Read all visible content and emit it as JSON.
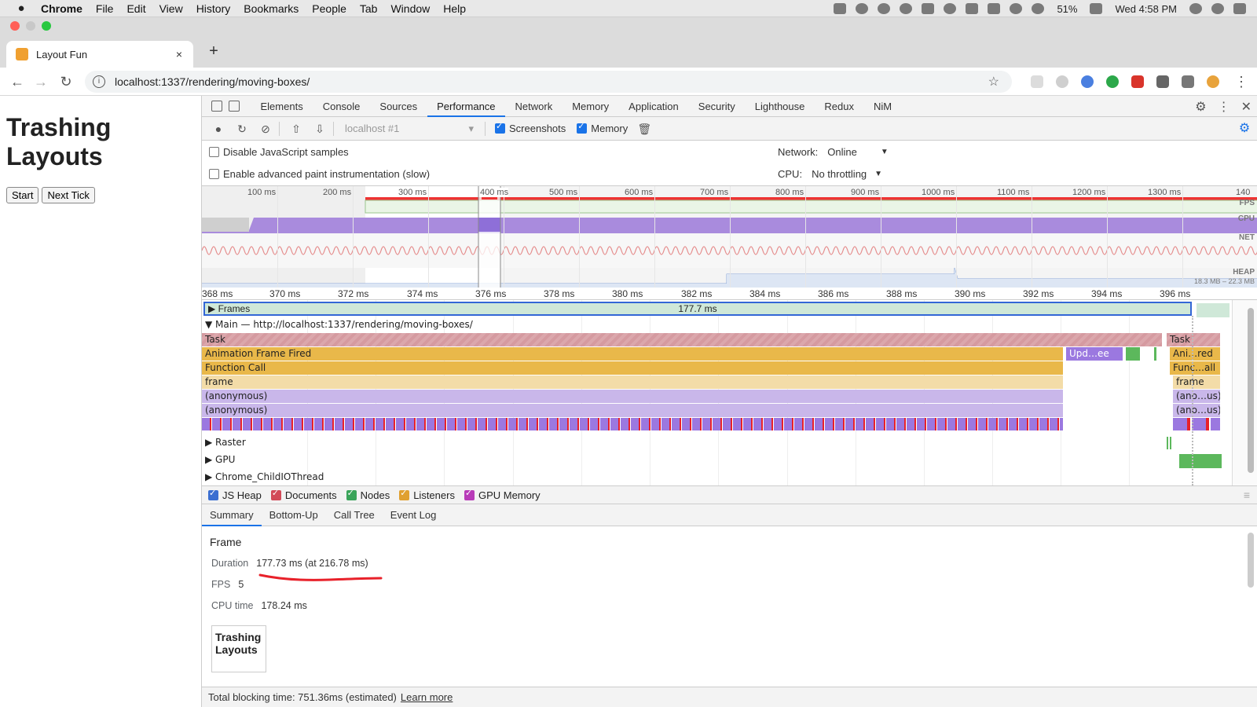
{
  "menubar": {
    "apple": "",
    "items": [
      "Chrome",
      "File",
      "Edit",
      "View",
      "History",
      "Bookmarks",
      "People",
      "Tab",
      "Window",
      "Help"
    ],
    "battery": "51%",
    "clock": "Wed 4:58 PM"
  },
  "browser": {
    "tab_title": "Layout Fun",
    "tab_close": "×",
    "new_tab": "+",
    "url": "localhost:1337/rendering/moving-boxes/",
    "back": "←",
    "forward": "→",
    "reload": "↻",
    "info": "i",
    "star": "☆",
    "menu": "⋮"
  },
  "page": {
    "heading": "Trashing Layouts",
    "start_button": "Start",
    "next_tick_button": "Next Tick"
  },
  "devtools": {
    "tabs": [
      "Elements",
      "Console",
      "Sources",
      "Performance",
      "Network",
      "Memory",
      "Application",
      "Security",
      "Lighthouse",
      "Redux",
      "NiM"
    ],
    "active_tab": "Performance",
    "close": "✕",
    "more": "⋮",
    "gear": "⚙"
  },
  "perf_toolbar": {
    "target_select": "localhost #1",
    "screenshots_label": "Screenshots",
    "memory_label": "Memory"
  },
  "settings": {
    "disable_js_samples": "Disable JavaScript samples",
    "advanced_paint": "Enable advanced paint instrumentation (slow)",
    "network_label": "Network:",
    "network_value": "Online",
    "cpu_label": "CPU:",
    "cpu_value": "No throttling"
  },
  "overview": {
    "ticks": [
      "100 ms",
      "200 ms",
      "300 ms",
      "400 ms",
      "500 ms",
      "600 ms",
      "700 ms",
      "800 ms",
      "900 ms",
      "1000 ms",
      "1100 ms",
      "1200 ms",
      "1300 ms",
      "140"
    ],
    "labels": [
      "FPS",
      "CPU",
      "NET",
      "HEAP"
    ],
    "heap_range": "18.3 MB – 22.3 MB"
  },
  "flame": {
    "ruler": [
      "368 ms",
      "370 ms",
      "372 ms",
      "374 ms",
      "376 ms",
      "378 ms",
      "380 ms",
      "382 ms",
      "384 ms",
      "386 ms",
      "388 ms",
      "390 ms",
      "392 ms",
      "394 ms",
      "396 ms"
    ],
    "frames_label": "Frames",
    "frames_duration": "177.7 ms",
    "main_label": "Main — http://localhost:1337/rendering/moving-boxes/",
    "rows": [
      "Task",
      "Animation Frame Fired",
      "Function Call",
      "frame",
      "(anonymous)",
      "(anonymous)"
    ],
    "right_rows": [
      "Task",
      "Ani…red",
      "Func…all",
      "frame",
      "(ano…us)",
      "(ano…us)"
    ],
    "upd_label": "Upd…ee",
    "raster_label": "Raster",
    "gpu_label": "GPU",
    "io_label": "Chrome_ChildIOThread"
  },
  "legend": [
    "JS Heap",
    "Documents",
    "Nodes",
    "Listeners",
    "GPU Memory"
  ],
  "summary_tabs": [
    "Summary",
    "Bottom-Up",
    "Call Tree",
    "Event Log"
  ],
  "summary": {
    "heading": "Frame",
    "duration_label": "Duration",
    "duration_value": "177.73 ms (at 216.78 ms)",
    "fps_label": "FPS",
    "fps_value": "5",
    "cpu_label": "CPU time",
    "cpu_value": "178.24 ms",
    "thumb_text": "Trashing Layouts"
  },
  "footer": {
    "text": "Total blocking time: 751.36ms (estimated)",
    "link": "Learn more"
  },
  "colors": {
    "task": "#d7a3a8",
    "animation": "#e9b84a",
    "frame": "#f3dca8",
    "anon": "#c9b7ea",
    "purple": "#9b78e0",
    "red": "#e8212a",
    "green": "#5cb85c",
    "accent": "#1a73e8"
  }
}
